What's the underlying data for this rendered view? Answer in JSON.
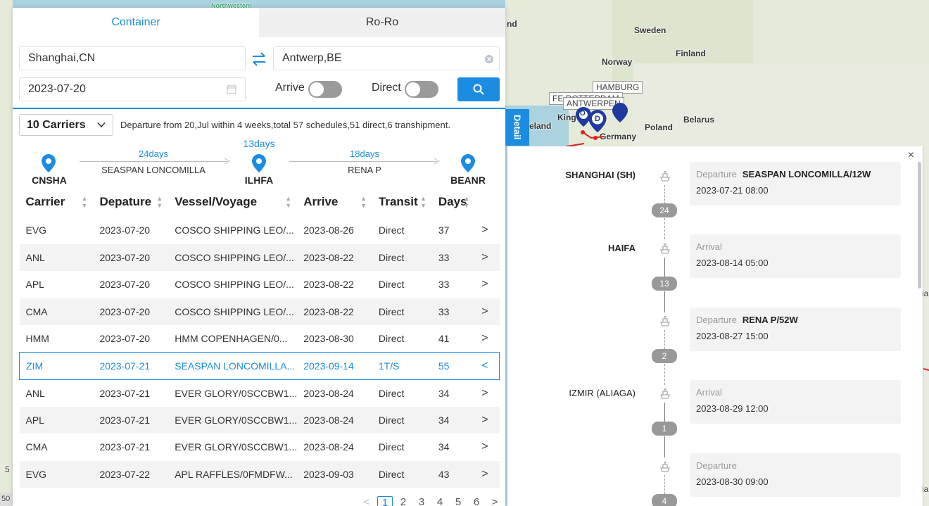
{
  "map": {
    "labels": [
      "Sweden",
      "Norway",
      "Finland",
      "Belarus",
      "Poland",
      "Germany",
      "eland",
      "King"
    ],
    "tags": [
      "HAMBURG",
      "ANTWERPEN",
      "FE ROTTERDAM"
    ],
    "pin_letters": [
      "O",
      "D"
    ],
    "edge_text": [
      "Northwestern",
      "nd",
      "ia",
      "5",
      "50",
      "ia"
    ]
  },
  "tabs": {
    "container": "Container",
    "roro": "Ro-Ro"
  },
  "search": {
    "origin": "Shanghai,CN",
    "destination": "Antwerp,BE",
    "date": "2023-07-20",
    "arrive_label": "Arrive",
    "direct_label": "Direct"
  },
  "carriers_select": "10 Carriers",
  "summary": "Departure from 20,Jul within 4 weeks,total 57 schedules,51 direct,6 transhipment.",
  "route": {
    "nodes": [
      "CNSHA",
      "ILHFA",
      "BEANR"
    ],
    "legs": [
      {
        "days": "24days",
        "vessel": "SEASPAN LONCOMILLA"
      },
      {
        "days": "18days",
        "vessel": "RENA P"
      }
    ],
    "transit_days": "13days"
  },
  "table": {
    "headers": [
      "Carrier",
      "Depature",
      "Vessel/Voyage",
      "Arrive",
      "Transit",
      "Days"
    ],
    "rows": [
      {
        "carrier": "EVG",
        "dep": "2023-07-20",
        "vessel": "COSCO SHIPPING LEO/...",
        "arr": "2023-08-26",
        "transit": "Direct",
        "days": "37",
        "arrow": ">"
      },
      {
        "carrier": "ANL",
        "dep": "2023-07-20",
        "vessel": "COSCO SHIPPING LEO/...",
        "arr": "2023-08-22",
        "transit": "Direct",
        "days": "33",
        "arrow": ">"
      },
      {
        "carrier": "APL",
        "dep": "2023-07-20",
        "vessel": "COSCO SHIPPING LEO/...",
        "arr": "2023-08-22",
        "transit": "Direct",
        "days": "33",
        "arrow": ">"
      },
      {
        "carrier": "CMA",
        "dep": "2023-07-20",
        "vessel": "COSCO SHIPPING LEO/...",
        "arr": "2023-08-22",
        "transit": "Direct",
        "days": "33",
        "arrow": ">"
      },
      {
        "carrier": "HMM",
        "dep": "2023-07-20",
        "vessel": "HMM COPENHAGEN/0...",
        "arr": "2023-08-30",
        "transit": "Direct",
        "days": "41",
        "arrow": ">"
      },
      {
        "carrier": "ZIM",
        "dep": "2023-07-21",
        "vessel": "SEASPAN LONCOMILLA...",
        "arr": "2023-09-14",
        "transit": "1T/S",
        "days": "55",
        "arrow": "<"
      },
      {
        "carrier": "ANL",
        "dep": "2023-07-21",
        "vessel": "EVER GLORY/0SCCBW1...",
        "arr": "2023-08-24",
        "transit": "Direct",
        "days": "34",
        "arrow": ">"
      },
      {
        "carrier": "APL",
        "dep": "2023-07-21",
        "vessel": "EVER GLORY/0SCCBW1...",
        "arr": "2023-08-24",
        "transit": "Direct",
        "days": "34",
        "arrow": ">"
      },
      {
        "carrier": "CMA",
        "dep": "2023-07-21",
        "vessel": "EVER GLORY/0SCCBW1...",
        "arr": "2023-08-24",
        "transit": "Direct",
        "days": "34",
        "arrow": ">"
      },
      {
        "carrier": "EVG",
        "dep": "2023-07-22",
        "vessel": "APL RAFFLES/0FMDFW...",
        "arr": "2023-09-03",
        "transit": "Direct",
        "days": "43",
        "arrow": ">"
      }
    ]
  },
  "pager": {
    "prev": "<",
    "pages": [
      "1",
      "2",
      "3",
      "4",
      "5",
      "6"
    ],
    "next": ">"
  },
  "detail_tab": "Detail",
  "detail": {
    "close": "×",
    "stops": [
      {
        "port": "SHANGHAI (SH)",
        "kind": "Departure",
        "vessel": "SEASPAN LONCOMILLA/12W",
        "time": "2023-07-21 08:00",
        "days": "24"
      },
      {
        "port": "HAIFA",
        "kind": "Arrival",
        "vessel": "",
        "time": "2023-08-14 05:00",
        "days": "13"
      },
      {
        "port": "",
        "kind": "Departure",
        "vessel": "RENA P/52W",
        "time": "2023-08-27 15:00",
        "days": "2"
      },
      {
        "port": "IZMIR (ALIAGA)",
        "kind": "Arrival",
        "vessel": "",
        "time": "2023-08-29 12:00",
        "days": "1"
      },
      {
        "port": "",
        "kind": "Departure",
        "vessel": "",
        "time": "2023-08-30 09:00",
        "days": "4"
      }
    ]
  },
  "colors": {
    "accent": "#1c8ce0",
    "map_water": "#aad3df",
    "map_land": "#e8ecdf",
    "badge": "#999999"
  }
}
